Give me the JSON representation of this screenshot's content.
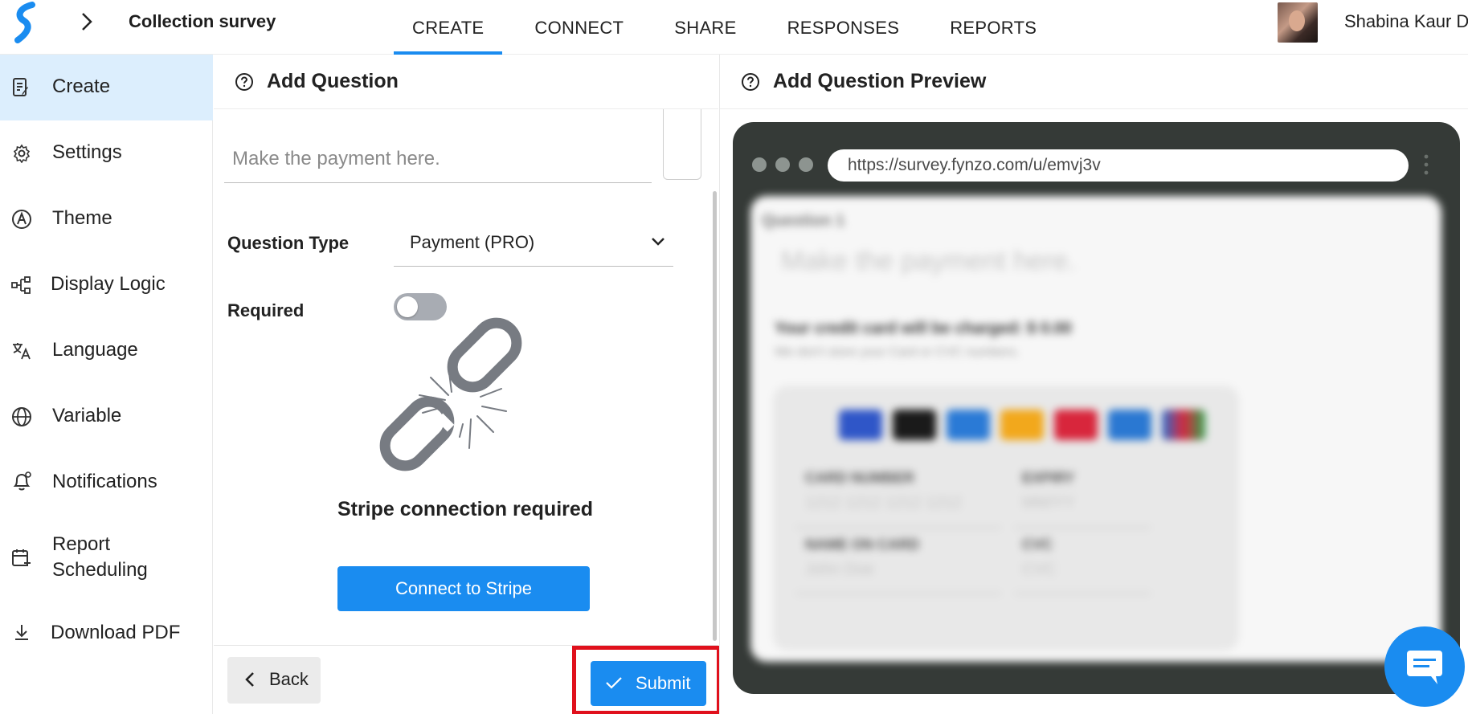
{
  "header": {
    "survey_title": "Collection survey",
    "tabs": [
      {
        "label": "CREATE",
        "active": true
      },
      {
        "label": "CONNECT",
        "active": false
      },
      {
        "label": "SHARE",
        "active": false
      },
      {
        "label": "RESPONSES",
        "active": false
      },
      {
        "label": "REPORTS",
        "active": false
      }
    ],
    "user_name": "Shabina Kaur D"
  },
  "sidebar": {
    "items": [
      {
        "label": "Create",
        "icon": "edit-document-icon",
        "active": true
      },
      {
        "label": "Settings",
        "icon": "gear-icon"
      },
      {
        "label": "Theme",
        "icon": "palette-icon"
      },
      {
        "label": "Display Logic",
        "icon": "flow-icon"
      },
      {
        "label": "Language",
        "icon": "translate-icon"
      },
      {
        "label": "Variable",
        "icon": "globe-icon"
      },
      {
        "label": "Notifications",
        "icon": "bell-icon"
      },
      {
        "label": "Report Scheduling",
        "icon": "calendar-plus-icon"
      },
      {
        "label": "Download PDF",
        "icon": "download-icon"
      }
    ]
  },
  "editor": {
    "title": "Add Question",
    "question_text": "Make the payment here.",
    "question_type_label": "Question Type",
    "question_type_value": "Payment (PRO)",
    "required_label": "Required",
    "required": false,
    "stripe_message": "Stripe connection required",
    "connect_label": "Connect to Stripe",
    "back_label": "Back",
    "submit_label": "Submit",
    "accent": "#1a8cf0",
    "highlight": "#e0101c"
  },
  "preview": {
    "title": "Add Question Preview",
    "url": "https://survey.fynzo.com/u/emvj3v",
    "question_number": "Question 1",
    "question_text": "Make the payment here.",
    "charge_text": "Your credit card will be charged: $ 0.00",
    "note": "We don't store your Card or CVC numbers.",
    "card_number_label": "CARD NUMBER",
    "card_number_placeholder": "1212 1212 1212 1212",
    "expiry_label": "EXPIRY",
    "expiry_placeholder": "MM/YY",
    "name_label": "NAME ON CARD",
    "name_placeholder": "John Doe",
    "cvc_label": "CVC",
    "cvc_placeholder": "CVC",
    "card_brand_colors": [
      "#2f56c8",
      "#1a1a1a",
      "#2a7ad6",
      "#f2a81c",
      "#d8263c",
      "#2a78d2",
      "#e8e8e8"
    ]
  }
}
